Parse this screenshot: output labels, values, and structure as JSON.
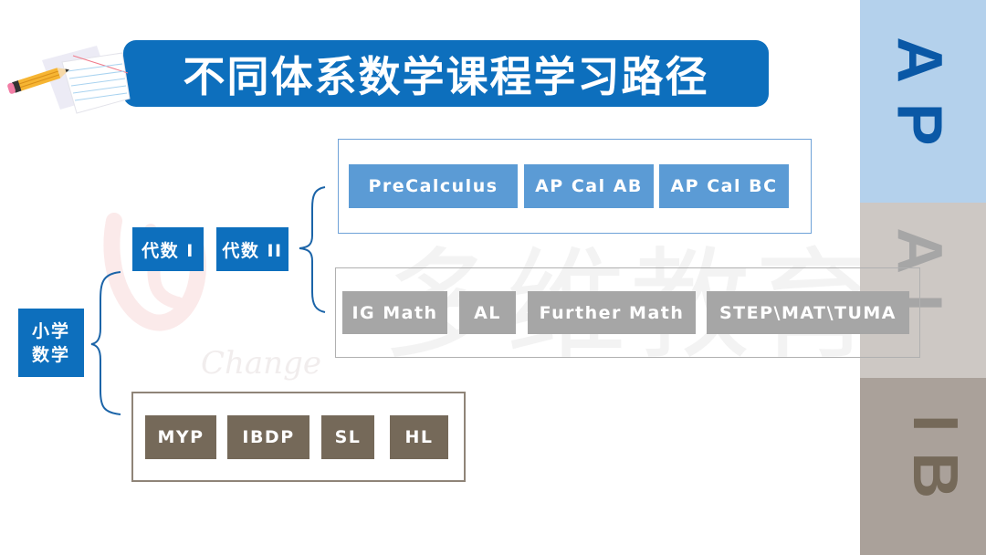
{
  "title": "不同体系数学课程学习路径",
  "watermark": {
    "chinese": "多维教育",
    "english": "Change"
  },
  "root": {
    "line1": "小学",
    "line2": "数学"
  },
  "algebra": [
    {
      "label": "代数 I"
    },
    {
      "label": "代数 II"
    }
  ],
  "ap_track": {
    "courses": [
      {
        "label": "PreCalculus"
      },
      {
        "label": "AP Cal AB"
      },
      {
        "label": "AP Cal BC"
      }
    ]
  },
  "al_track": {
    "courses": [
      {
        "label": "IG Math"
      },
      {
        "label": "AL"
      },
      {
        "label": "Further Math"
      },
      {
        "label": "STEP\\MAT\\TUMA"
      }
    ]
  },
  "ib_track": {
    "courses": [
      {
        "label": "MYP"
      },
      {
        "label": "IBDP"
      },
      {
        "label": "SL"
      },
      {
        "label": "HL"
      }
    ]
  },
  "side_panel": {
    "ap": "AP",
    "al": "AL",
    "ib": "IB"
  },
  "colors": {
    "primary_blue": "#0d6fbd",
    "ap_blue": "#5b9bd5",
    "al_gray": "#a6a6a6",
    "ib_brown": "#756959",
    "panel_ap": "#b4d1ec",
    "panel_al": "#cdc8c4",
    "panel_ib": "#aaa19a"
  }
}
